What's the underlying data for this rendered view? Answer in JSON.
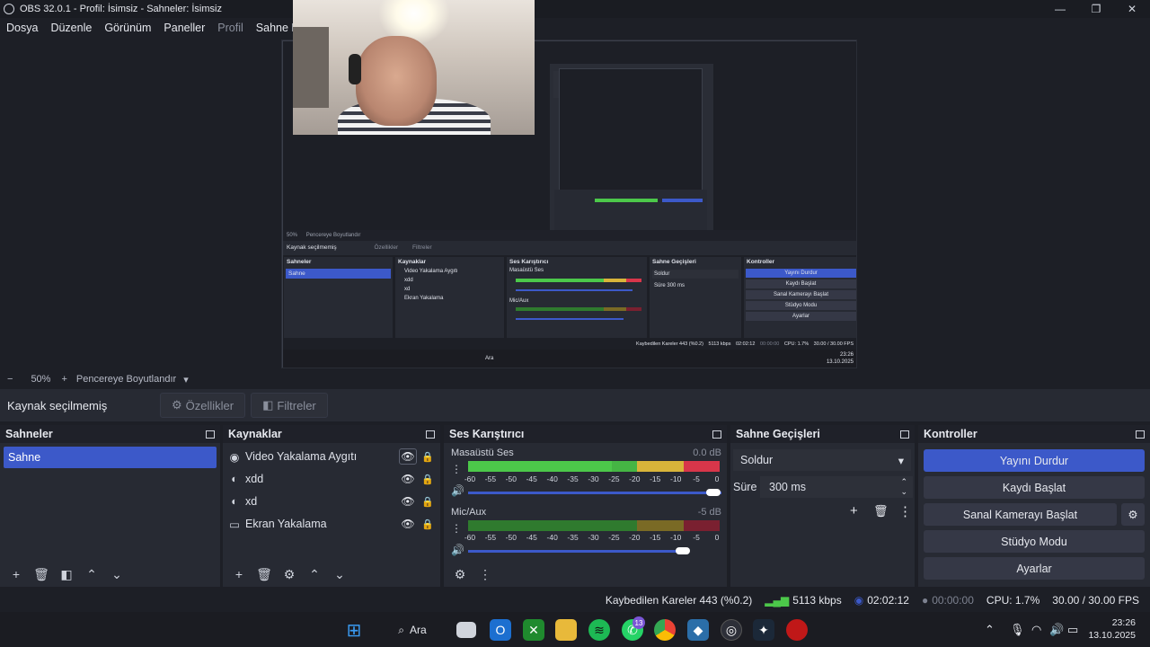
{
  "window": {
    "title": "OBS 32.0.1 - Profil: İsimsiz - Sahneler: İsimsiz",
    "minimize": "—",
    "maximize": "❐",
    "close": "✕"
  },
  "menu": {
    "items": [
      "Dosya",
      "Düzenle",
      "Görünüm",
      "Paneller",
      "Profil",
      "Sahne Koleks"
    ]
  },
  "preview": {
    "nested": {
      "no_selection": "Kaynak seçilmemiş",
      "properties": "Özellikler",
      "filters": "Filtreler",
      "zoom": "50%",
      "fit": "Pencereye Boyutlandır",
      "scenes_title": "Sahneler",
      "scene": "Sahne",
      "sources_title": "Kaynaklar",
      "sources": [
        "Video Yakalama Aygıtı",
        "xdd",
        "xd",
        "Ekran Yakalama"
      ],
      "mixer_title": "Ses Karıştırıcı",
      "desktop": "Masaüstü Ses",
      "desktop_db": "0.0 dB",
      "mic": "Mic/Aux",
      "transitions_title": "Sahne Geçişleri",
      "transition": "Soldur",
      "duration_label": "Süre",
      "duration": "300 ms",
      "controls_title": "Kontroller",
      "controls": [
        "Yayını Durdur",
        "Kaydı Başlat",
        "Sanal Kamerayı Başlat",
        "Stüdyo Modu",
        "Ayarlar"
      ],
      "status": "Kaybedilen Kareler 443 (%0.2)",
      "kbps": "5113 kbps",
      "time": "02:02:12",
      "rec": "00:00:00",
      "cpu": "CPU: 1.7%",
      "fps": "30.00 / 30.00 FPS",
      "search": "Ara",
      "clock_time": "23:26",
      "clock_date": "13.10.2025"
    }
  },
  "zoom": {
    "minus": "−",
    "value": "50%",
    "plus": "+",
    "fit_label": "Pencereye Boyutlandır"
  },
  "selection": {
    "no_selection": "Kaynak seçilmemiş",
    "properties": "Özellikler",
    "filters": "Filtreler"
  },
  "scenes": {
    "title": "Sahneler",
    "items": [
      "Sahne"
    ]
  },
  "sources": {
    "title": "Kaynaklar",
    "items": [
      {
        "label": "Video Yakalama Aygıtı",
        "icon": "camera-icon"
      },
      {
        "label": "xdd",
        "icon": "browser-icon"
      },
      {
        "label": "xd",
        "icon": "browser-icon"
      },
      {
        "label": "Ekran Yakalama",
        "icon": "monitor-icon"
      }
    ]
  },
  "mixer": {
    "title": "Ses Karıştırıcı",
    "channels": [
      {
        "name": "Masaüstü Ses",
        "db": "0.0 dB",
        "volume": 1.0
      },
      {
        "name": "Mic/Aux",
        "db": "-5 dB",
        "volume": 0.85
      }
    ],
    "scale": [
      "-60",
      "-55",
      "-50",
      "-45",
      "-40",
      "-35",
      "-30",
      "-25",
      "-20",
      "-15",
      "-10",
      "-5",
      "0"
    ]
  },
  "transitions": {
    "title": "Sahne Geçişleri",
    "selected": "Soldur",
    "duration_label": "Süre",
    "duration": "300 ms"
  },
  "controls": {
    "title": "Kontroller",
    "stop_stream": "Yayını Durdur",
    "start_record": "Kaydı Başlat",
    "start_vcam": "Sanal Kamerayı Başlat",
    "studio_mode": "Stüdyo Modu",
    "settings": "Ayarlar"
  },
  "status": {
    "dropped": "Kaybedilen Kareler 443 (%0.2)",
    "kbps": "5113 kbps",
    "stream_time": "02:02:12",
    "rec_time": "00:00:00",
    "cpu": "CPU: 1.7%",
    "fps": "30.00 / 30.00 FPS"
  },
  "taskbar": {
    "search": "Ara",
    "whatsapp_badge": "13",
    "time": "23:26",
    "date": "13.10.2025"
  },
  "colors": {
    "accent": "#3c59c9",
    "meter_green": "#4cc84a",
    "meter_yellow": "#d8b43a",
    "meter_red": "#d8364a"
  }
}
